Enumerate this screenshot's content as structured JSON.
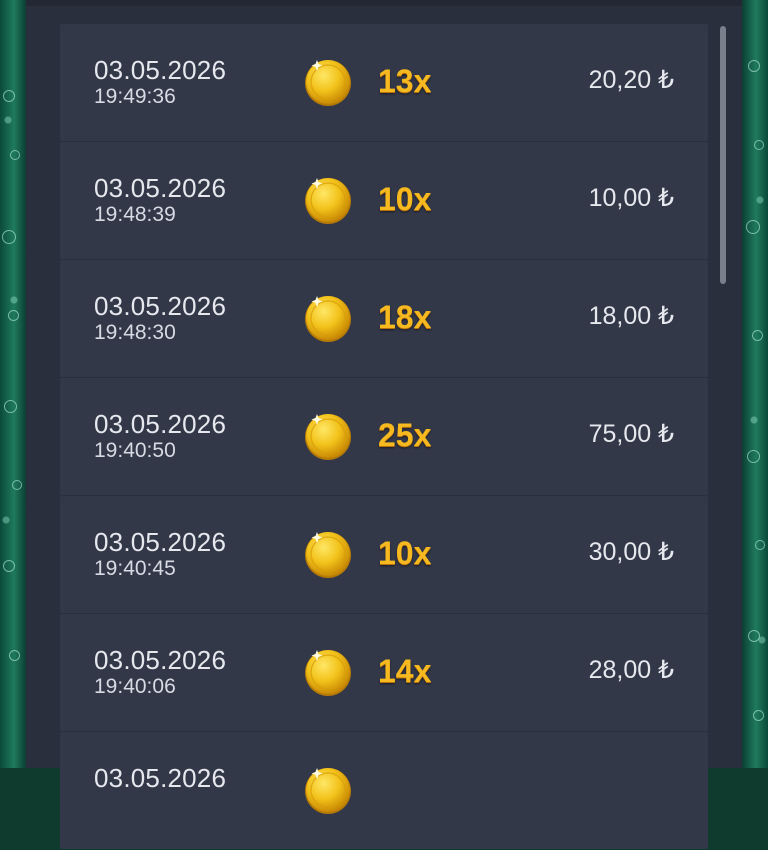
{
  "history": {
    "rows": [
      {
        "date": "03.05.2026",
        "time": "19:49:36",
        "multiplier": "13x",
        "amount": "20,20 ₺",
        "icon": "gold-coin-icon"
      },
      {
        "date": "03.05.2026",
        "time": "19:48:39",
        "multiplier": "10x",
        "amount": "10,00 ₺",
        "icon": "gold-coin-icon"
      },
      {
        "date": "03.05.2026",
        "time": "19:48:30",
        "multiplier": "18x",
        "amount": "18,00 ₺",
        "icon": "gold-coin-icon"
      },
      {
        "date": "03.05.2026",
        "time": "19:40:50",
        "multiplier": "25x",
        "amount": "75,00 ₺",
        "icon": "gold-coin-icon"
      },
      {
        "date": "03.05.2026",
        "time": "19:40:45",
        "multiplier": "10x",
        "amount": "30,00 ₺",
        "icon": "gold-coin-icon"
      },
      {
        "date": "03.05.2026",
        "time": "19:40:06",
        "multiplier": "14x",
        "amount": "28,00 ₺",
        "icon": "gold-coin-icon"
      },
      {
        "date": "03.05.2026",
        "time": "",
        "multiplier": "",
        "amount": "",
        "icon": "gold-coin-icon"
      }
    ]
  },
  "colors": {
    "panel": "#2a2f3d",
    "row": "#333849",
    "multiplier": "#f6b91f",
    "coin": "#f2c21a",
    "background": "#0f3a2e"
  }
}
